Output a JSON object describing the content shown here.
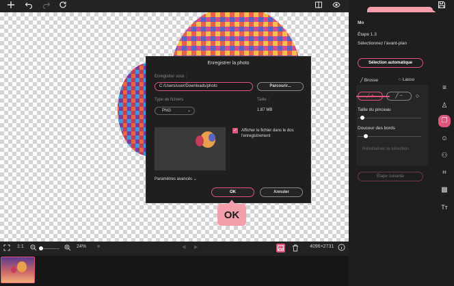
{
  "toolbar": {
    "add_icon": "plus-icon",
    "undo_icon": "undo-icon",
    "redo_icon": "redo-icon",
    "refresh_icon": "refresh-icon",
    "compare_icon": "compare-icon",
    "eye_icon": "eye-icon",
    "save_icon": "floppy-disk-icon"
  },
  "dialog": {
    "title": "Enregistrer la photo",
    "save_as_label": "Enregistrer sous :",
    "path_value": "C:/Users/user/Downloads/photo",
    "browse_label": "Parcourir...",
    "filetype_label": "Type de fichiers",
    "filetype_value": "PNG",
    "size_label": "Taille :",
    "size_value": "1.87 MB",
    "show_file_label": "Afficher le fichier dans le dossier après l'enregistrement",
    "show_file_line1": "Afficher le fichier dans le dos",
    "show_file_line2": "l'enregistrement",
    "show_file_checked": true,
    "advanced_label": "Paramètres avancés",
    "ok_label": "OK",
    "cancel_label": "Annuler"
  },
  "callouts": {
    "ok": "OK",
    "disk": "Disquette"
  },
  "bottombar": {
    "ratio": "1:1",
    "zoom": "24%",
    "dimensions": "4096×2731"
  },
  "panel": {
    "mode": "Mo",
    "step": "Étape 1.3",
    "instruction": "Sélectionnez l'avant-plan",
    "auto_select": "Sélection automatique",
    "tab_brush": "Brosse",
    "tab_lasso": "Lasso",
    "brush_size": "Taille du pinceau",
    "edge_softness": "Douceur des bords",
    "reset_selection": "Réinitialiser la sélection",
    "next_step": "Étape suivante"
  },
  "colors": {
    "accent": "#e0557a",
    "callout": "#f3a0ac"
  }
}
